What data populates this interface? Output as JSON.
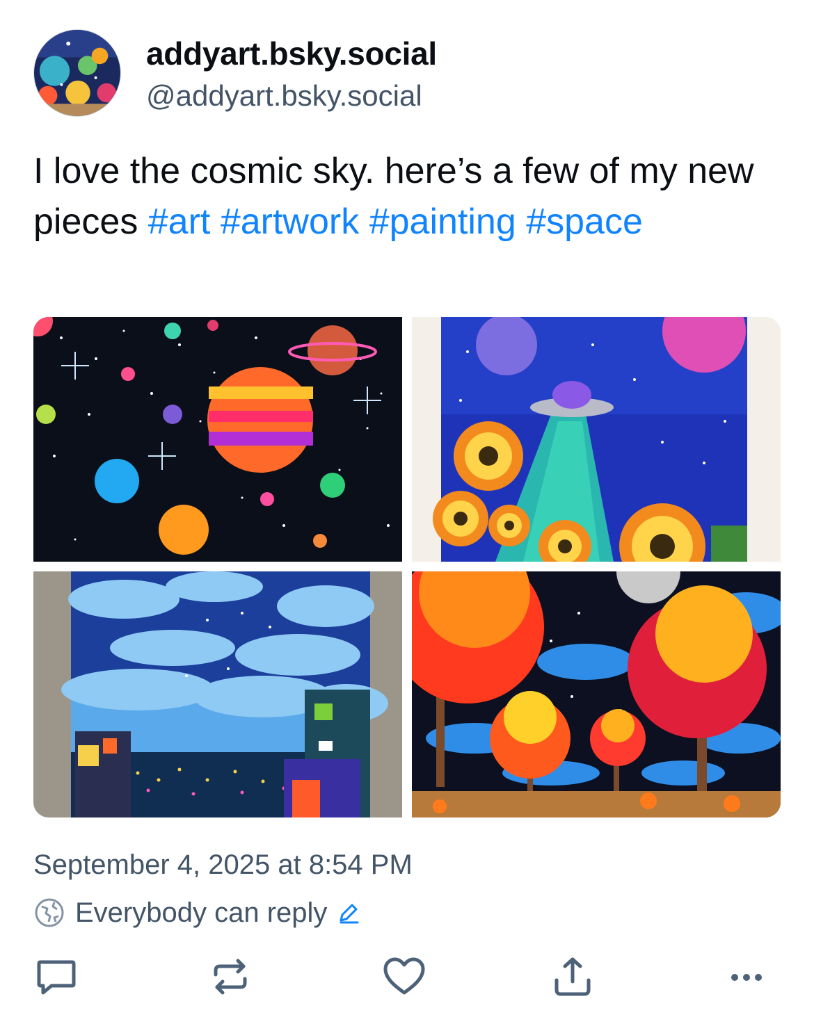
{
  "author": {
    "display_name": "addyart.bsky.social",
    "handle": "@addyart.bsky.social"
  },
  "post": {
    "text_prefix": "I love the cosmic sky. here’s a few of my new pieces ",
    "hashtags": [
      "#art",
      "#artwork",
      "#painting",
      "#space"
    ],
    "images": [
      {
        "icon": "painting-planets-image"
      },
      {
        "icon": "painting-ufo-sunflowers-image"
      },
      {
        "icon": "painting-city-clouds-image"
      },
      {
        "icon": "painting-autumn-trees-image"
      }
    ]
  },
  "meta": {
    "timestamp": "September 4, 2025 at 8:54 PM",
    "reply_setting": "Everybody can reply"
  },
  "actions": {
    "reply_icon": "comment-icon",
    "repost_icon": "repost-icon",
    "like_icon": "heart-icon",
    "share_icon": "share-icon",
    "more_icon": "more-icon"
  },
  "colors": {
    "link": "#1083fe",
    "text": "#0b0f14",
    "secondary": "#425466"
  }
}
